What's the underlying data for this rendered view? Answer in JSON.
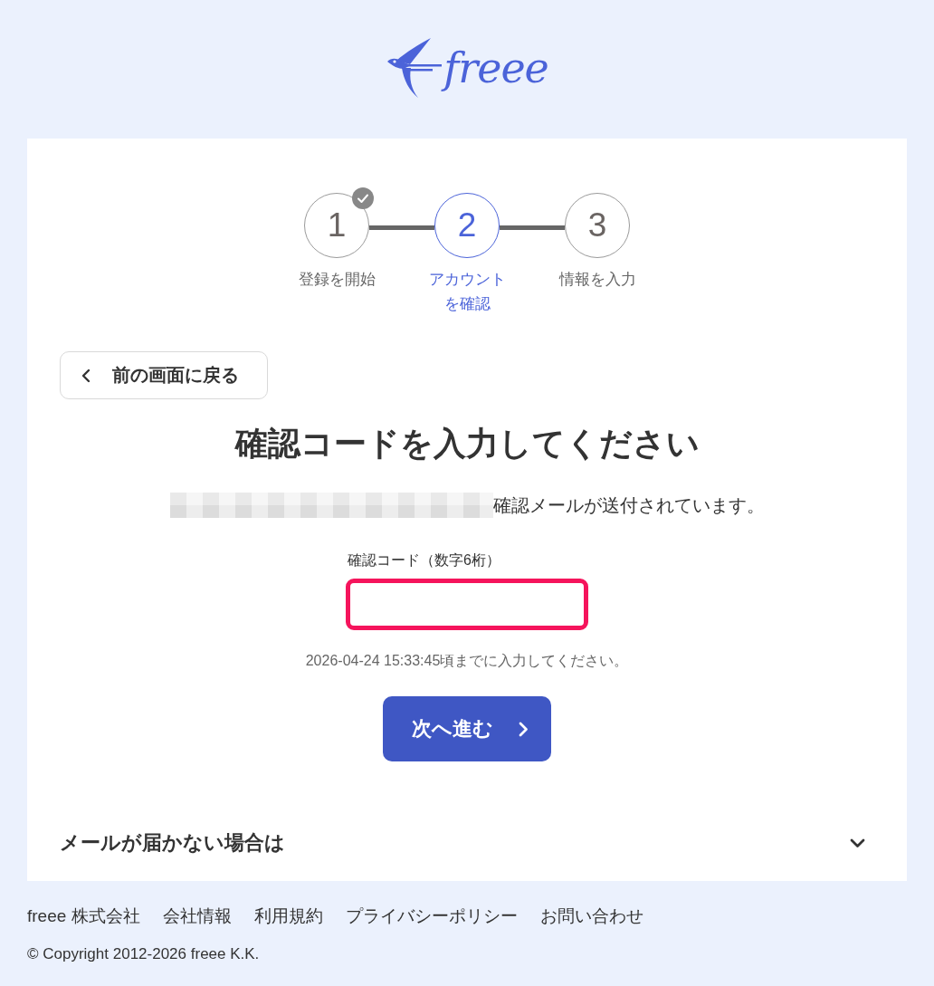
{
  "logo": {
    "text": "freee"
  },
  "stepper": {
    "steps": [
      {
        "number": "1",
        "label": "登録を開始",
        "completed": true,
        "selected": false
      },
      {
        "number": "2",
        "label": "アカウントを確認",
        "completed": false,
        "selected": true
      },
      {
        "number": "3",
        "label": "情報を入力",
        "completed": false,
        "selected": false
      }
    ]
  },
  "back_button": {
    "label": "前の画面に戻る"
  },
  "heading": "確認コードを入力してください",
  "notice": "確認メールが送付されています。",
  "code_field": {
    "label": "確認コード（数字6桁）",
    "invalid": true
  },
  "deadline": "2026-04-24 15:33:45頃までに入力してください。",
  "next_button": {
    "label": "次へ進む"
  },
  "help_section": {
    "title": "メールが届かない場合は",
    "expanded": false
  },
  "footer": {
    "links": [
      "freee 株式会社",
      "会社情報",
      "利用規約",
      "プライバシーポリシー",
      "お問い合わせ"
    ],
    "copyright": "© Copyright 2012-2026 freee K.K."
  }
}
